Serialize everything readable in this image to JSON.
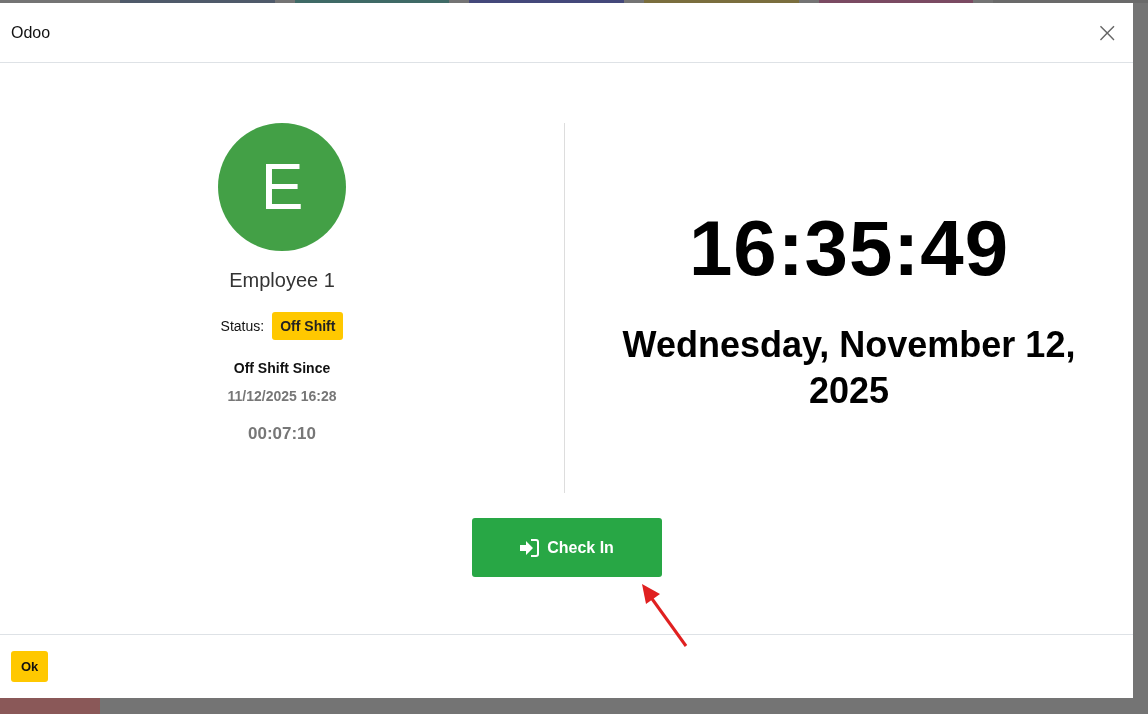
{
  "dialog": {
    "title": "Odoo",
    "close_label": "×"
  },
  "employee": {
    "initial": "E",
    "name": "Employee 1",
    "status_label": "Status:",
    "status": "Off Shift",
    "since_label": "Off Shift Since",
    "since": "11/12/2025 16:28",
    "elapsed": "00:07:10"
  },
  "clock": {
    "time": "16:35:49",
    "date": "Wednesday, November 12, 2025"
  },
  "check_in_button": {
    "label": "Check In"
  },
  "footer": {
    "buttons": [
      "Ok"
    ]
  }
}
